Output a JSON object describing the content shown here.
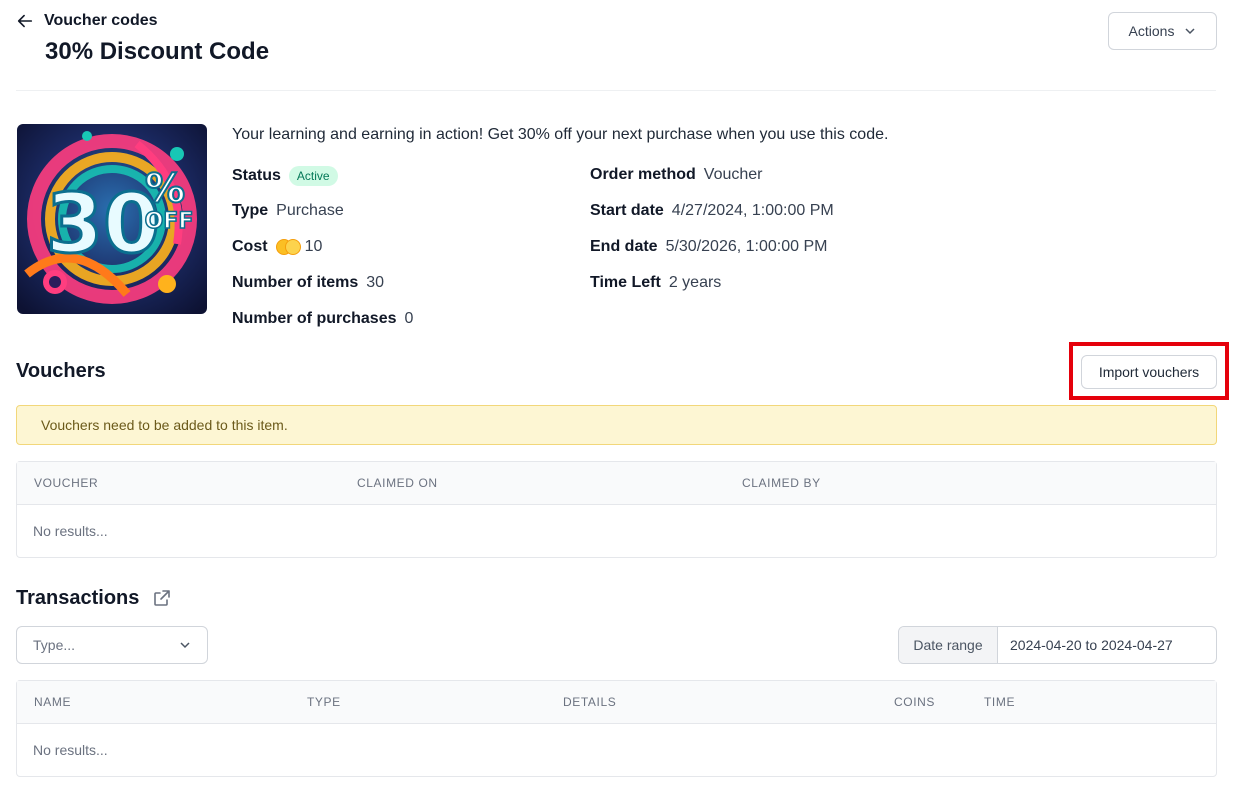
{
  "header": {
    "back_label": "Voucher codes",
    "title": "30% Discount Code",
    "actions_label": "Actions"
  },
  "hero_image": {
    "big_text": "30",
    "percent": "%",
    "off": "OFF"
  },
  "details": {
    "description": "Your learning and earning in action! Get 30% off your next purchase when you use this code.",
    "status_label": "Status",
    "status_value": "Active",
    "type_label": "Type",
    "type_value": "Purchase",
    "cost_label": "Cost",
    "cost_value": "10",
    "items_label": "Number of items",
    "items_value": "30",
    "purchases_label": "Number of purchases",
    "purchases_value": "0",
    "order_method_label": "Order method",
    "order_method_value": "Voucher",
    "start_label": "Start date",
    "start_value": "4/27/2024, 1:00:00 PM",
    "end_label": "End date",
    "end_value": "5/30/2026, 1:00:00 PM",
    "time_left_label": "Time Left",
    "time_left_value": "2 years"
  },
  "vouchers": {
    "title": "Vouchers",
    "import_label": "Import vouchers",
    "notice": "Vouchers need to be added to this item.",
    "columns": [
      "VOUCHER",
      "CLAIMED ON",
      "CLAIMED BY"
    ],
    "empty": "No results..."
  },
  "transactions": {
    "title": "Transactions",
    "type_placeholder": "Type...",
    "date_range_label": "Date range",
    "date_range_value": "2024-04-20 to 2024-04-27",
    "columns": [
      "NAME",
      "TYPE",
      "DETAILS",
      "COINS",
      "TIME"
    ],
    "empty": "No results..."
  },
  "colors": {
    "active_badge_bg": "#d1fae5",
    "active_badge_text": "#047857",
    "highlight": "#e5000b",
    "notice_bg": "#fdf6d3"
  }
}
